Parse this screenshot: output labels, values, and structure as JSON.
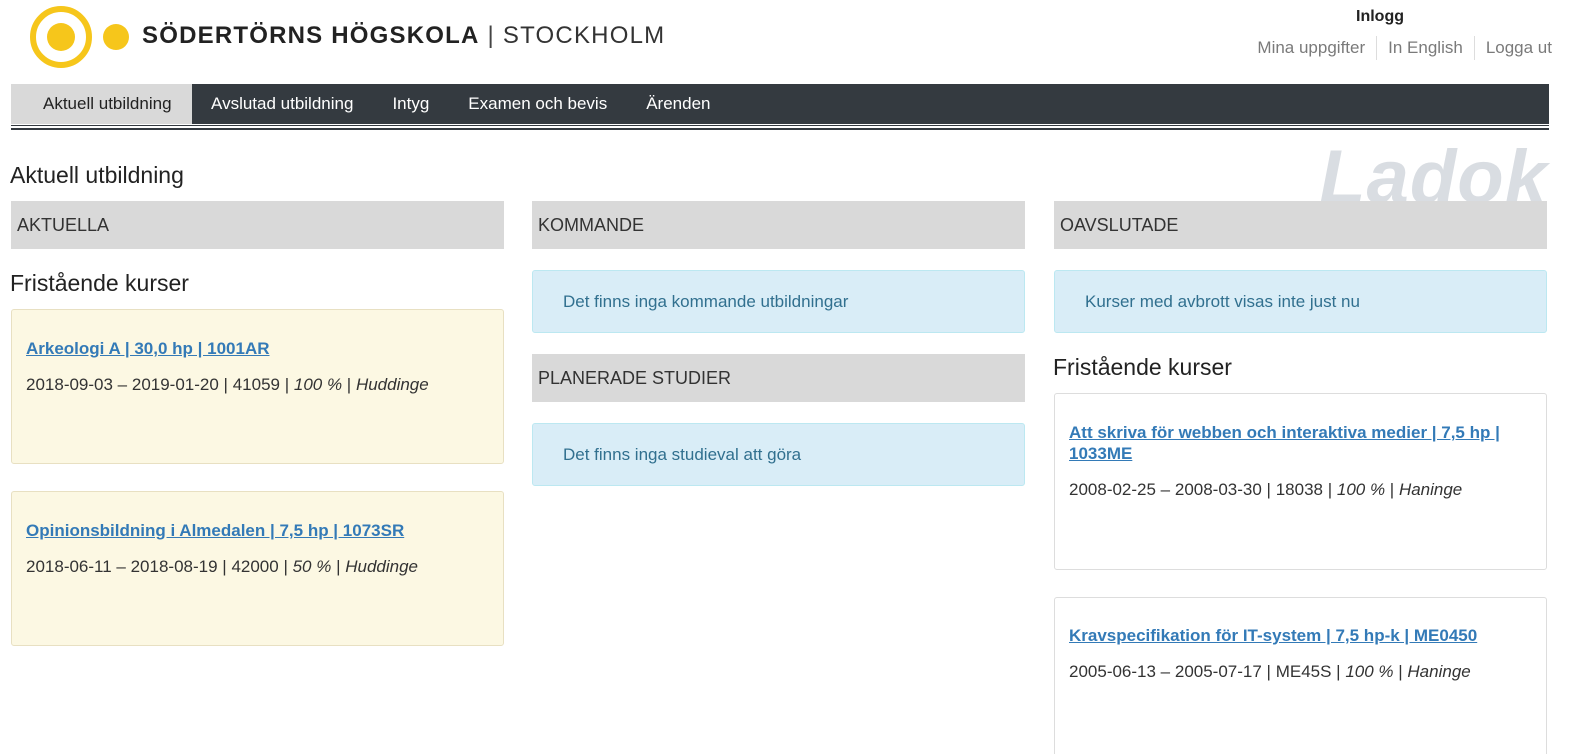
{
  "brand": {
    "name": "SÖDERTÖRNS HÖGSKOLA",
    "separator": "|",
    "city": "STOCKHOLM"
  },
  "header": {
    "login_label": "Inlogg",
    "links": [
      "Mina uppgifter",
      "In English",
      "Logga ut"
    ]
  },
  "nav": {
    "tabs": [
      "Aktuell utbildning",
      "Avslutad utbildning",
      "Intyg",
      "Examen och bevis",
      "Ärenden"
    ],
    "active": "Aktuell utbildning"
  },
  "page": {
    "title": "Aktuell utbildning",
    "watermark": "Ladok"
  },
  "aktuella": {
    "heading": "AKTUELLA",
    "group_title": "Fristående kurser",
    "courses": [
      {
        "title": "Arkeologi A | 30,0 hp | 1001AR",
        "dates": "2018-09-03 – 2019-01-20",
        "code": "41059",
        "pace": "100 %",
        "location": "Huddinge"
      },
      {
        "title": "Opinionsbildning i Almedalen | 7,5 hp | 1073SR",
        "dates": "2018-06-11 – 2018-08-19",
        "code": "42000",
        "pace": "50 %",
        "location": "Huddinge"
      }
    ]
  },
  "kommande": {
    "heading": "KOMMANDE",
    "empty_message": "Det finns inga kommande utbildningar",
    "planned_heading": "PLANERADE STUDIER",
    "planned_empty_message": "Det finns inga studieval att göra"
  },
  "oavslutade": {
    "heading": "OAVSLUTADE",
    "notice": "Kurser med avbrott visas inte just nu",
    "group_title": "Fristående kurser",
    "courses": [
      {
        "title": "Att skriva för webben och interaktiva medier | 7,5 hp | 1033ME",
        "dates": "2008-02-25 – 2008-03-30",
        "code": "18038",
        "pace": "100 %",
        "location": "Haninge"
      },
      {
        "title": "Kravspecifikation för IT-system | 7,5 hp-k | ME0450",
        "dates": "2005-06-13 – 2005-07-17",
        "code": "ME45S",
        "pace": "100 %",
        "location": "Haninge"
      }
    ]
  },
  "colors": {
    "navbar": "#343a40",
    "active_tab": "#d9d9d9",
    "section_head": "#d9d9d9",
    "info_bg": "#d9edf7",
    "info_text": "#31708f",
    "current_card_bg": "#fcf8e3",
    "link": "#337ab7",
    "logo_yellow": "#f6c61b"
  }
}
